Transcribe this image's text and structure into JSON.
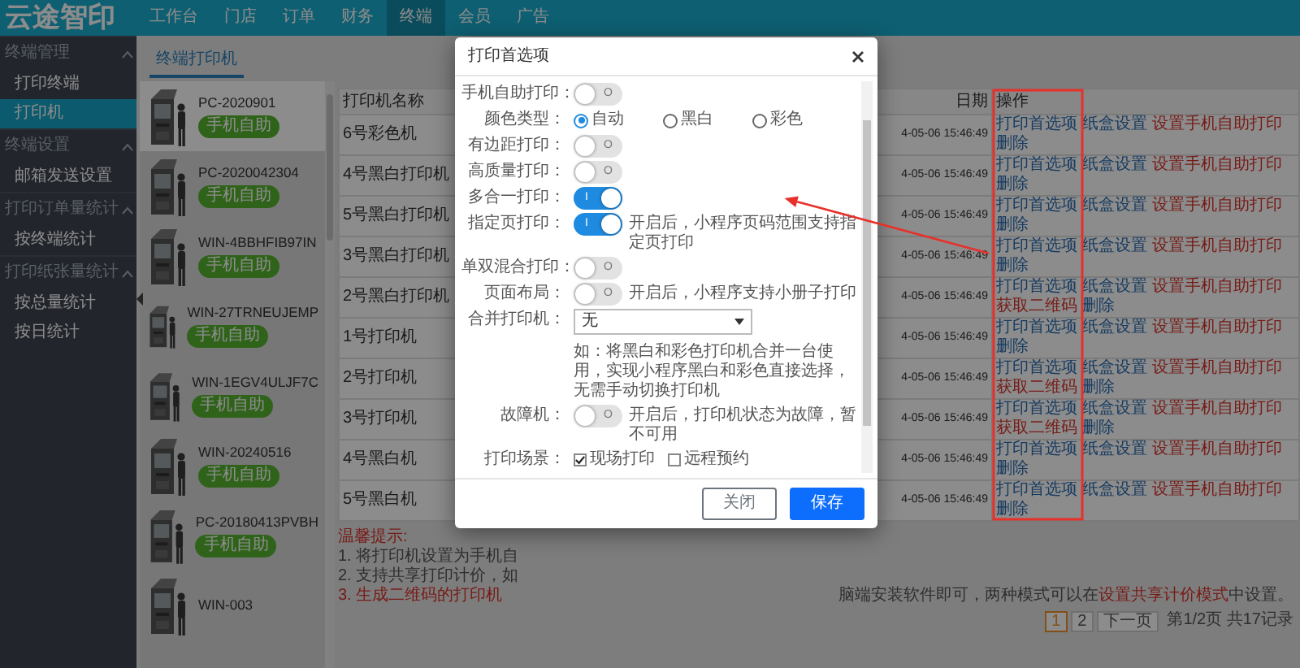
{
  "topbar": {
    "logo": "云途智印",
    "menu": [
      {
        "label": "工作台",
        "selected": false
      },
      {
        "label": "门店",
        "selected": false
      },
      {
        "label": "订单",
        "selected": false
      },
      {
        "label": "财务",
        "selected": false
      },
      {
        "label": "终端",
        "selected": true
      },
      {
        "label": "会员",
        "selected": false
      },
      {
        "label": "广告",
        "selected": false
      }
    ]
  },
  "sidebar": {
    "groups": [
      {
        "title": "终端管理",
        "expanded": true,
        "items": [
          {
            "label": "打印终端",
            "selected": false
          },
          {
            "label": "打印机",
            "selected": true
          }
        ]
      },
      {
        "title": "终端设置",
        "expanded": true,
        "items": [
          {
            "label": "邮箱发送设置",
            "selected": false
          }
        ]
      },
      {
        "title": "打印订单量统计",
        "expanded": true,
        "items": [
          {
            "label": "按终端统计",
            "selected": false
          }
        ]
      },
      {
        "title": "打印纸张量统计",
        "expanded": true,
        "items": [
          {
            "label": "按总量统计",
            "selected": false
          },
          {
            "label": "按日统计",
            "selected": false
          }
        ]
      }
    ]
  },
  "tabs": [
    {
      "label": "终端打印机",
      "selected": true
    }
  ],
  "devices": [
    {
      "name": "PC-2020901",
      "badge": "手机自助",
      "selected": true
    },
    {
      "name": "PC-2020042304",
      "badge": "手机自助",
      "selected": false
    },
    {
      "name": "WIN-4BBHFIB97IN",
      "badge": "手机自助",
      "selected": false
    },
    {
      "name": "WIN-27TRNEUJEMP",
      "badge": "手机自助",
      "selected": false
    },
    {
      "name": "WIN-1EGV4ULJF7C",
      "badge": "手机自助",
      "selected": false
    },
    {
      "name": "WIN-20240516",
      "badge": "手机自助",
      "selected": false
    },
    {
      "name": "PC-20180413PVBH",
      "badge": "手机自助",
      "selected": false
    },
    {
      "name": "WIN-003",
      "selected": false
    }
  ],
  "printer_table": {
    "columns": [
      "打印机名称",
      "日期",
      "操作"
    ],
    "rows": [
      {
        "name": "6号彩色机",
        "date": "4-05-06 15:46:49",
        "actions": [
          {
            "label": "打印首选项",
            "kind": "link"
          },
          {
            "label": "纸盒设置",
            "kind": "link"
          },
          {
            "label": "设置手机自助打印",
            "kind": "danger"
          },
          {
            "label": "删除",
            "kind": "link"
          }
        ]
      },
      {
        "name": "4号黑白打印机",
        "date": "4-05-06 15:46:49",
        "actions": [
          {
            "label": "打印首选项",
            "kind": "link"
          },
          {
            "label": "纸盒设置",
            "kind": "link"
          },
          {
            "label": "设置手机自助打印",
            "kind": "danger"
          },
          {
            "label": "删除",
            "kind": "link"
          }
        ]
      },
      {
        "name": "5号黑白打印机",
        "date": "4-05-06 15:46:49",
        "actions": [
          {
            "label": "打印首选项",
            "kind": "link"
          },
          {
            "label": "纸盒设置",
            "kind": "link"
          },
          {
            "label": "设置手机自助打印",
            "kind": "danger"
          },
          {
            "label": "删除",
            "kind": "link"
          }
        ]
      },
      {
        "name": "3号黑白打印机",
        "date": "4-05-06 15:46:49",
        "actions": [
          {
            "label": "打印首选项",
            "kind": "link"
          },
          {
            "label": "纸盒设置",
            "kind": "link"
          },
          {
            "label": "设置手机自助打印",
            "kind": "danger"
          },
          {
            "label": "删除",
            "kind": "link"
          }
        ]
      },
      {
        "name": "2号黑白打印机",
        "date": "4-05-06 15:46:49",
        "actions": [
          {
            "label": "打印首选项",
            "kind": "link"
          },
          {
            "label": "纸盒设置",
            "kind": "link"
          },
          {
            "label": "设置手机自助打印",
            "kind": "danger"
          },
          {
            "label": "获取二维码",
            "kind": "danger"
          },
          {
            "label": "删除",
            "kind": "link"
          }
        ]
      },
      {
        "name": "1号打印机",
        "date": "4-05-06 15:46:49",
        "actions": [
          {
            "label": "打印首选项",
            "kind": "link"
          },
          {
            "label": "纸盒设置",
            "kind": "link"
          },
          {
            "label": "设置手机自助打印",
            "kind": "danger"
          },
          {
            "label": "删除",
            "kind": "link"
          }
        ]
      },
      {
        "name": "2号打印机",
        "date": "4-05-06 15:46:49",
        "actions": [
          {
            "label": "打印首选项",
            "kind": "link"
          },
          {
            "label": "纸盒设置",
            "kind": "link"
          },
          {
            "label": "设置手机自助打印",
            "kind": "danger"
          },
          {
            "label": "获取二维码",
            "kind": "danger"
          },
          {
            "label": "删除",
            "kind": "link"
          }
        ]
      },
      {
        "name": "3号打印机",
        "date": "4-05-06 15:46:49",
        "actions": [
          {
            "label": "打印首选项",
            "kind": "link"
          },
          {
            "label": "纸盒设置",
            "kind": "link"
          },
          {
            "label": "设置手机自助打印",
            "kind": "danger"
          },
          {
            "label": "获取二维码",
            "kind": "danger"
          },
          {
            "label": "删除",
            "kind": "link"
          }
        ]
      },
      {
        "name": "4号黑白机",
        "date": "4-05-06 15:46:49",
        "actions": [
          {
            "label": "打印首选项",
            "kind": "link"
          },
          {
            "label": "纸盒设置",
            "kind": "link"
          },
          {
            "label": "设置手机自助打印",
            "kind": "danger"
          },
          {
            "label": "删除",
            "kind": "link"
          }
        ]
      },
      {
        "name": "5号黑白机",
        "date": "4-05-06 15:46:49",
        "actions": [
          {
            "label": "打印首选项",
            "kind": "link"
          },
          {
            "label": "纸盒设置",
            "kind": "link"
          },
          {
            "label": "设置手机自助打印",
            "kind": "danger"
          },
          {
            "label": "删除",
            "kind": "link"
          }
        ]
      }
    ]
  },
  "tips": {
    "title": "温馨提示:",
    "lines": [
      {
        "number": "1.",
        "text": "将打印机设置为手机自",
        "kind": "normal"
      },
      {
        "number": "2.",
        "text": "支持共享打印计价，如",
        "kind": "normal"
      },
      {
        "number": "3.",
        "text": "生成二维码的打印机",
        "kind": "warning",
        "tail": [
          {
            "text": "脑端安装软件即可，两种模式可以在",
            "kind": "normal"
          },
          {
            "text": "设置共享计价模式",
            "kind": "warning"
          },
          {
            "text": "中设置。",
            "kind": "normal"
          }
        ]
      }
    ]
  },
  "pagination": {
    "pages": [
      {
        "label": "1",
        "selected": true
      },
      {
        "label": "2",
        "selected": false
      }
    ],
    "next": "下一页",
    "summary": "第1/2页 共17记录"
  },
  "modal": {
    "title": "打印首选项",
    "fields": [
      {
        "label": "手机自助打印：",
        "kind": "toggle",
        "on": false,
        "symbol": "O"
      },
      {
        "label": "颜色类型：",
        "kind": "radio",
        "options": [
          {
            "label": "自动",
            "selected": true
          },
          {
            "label": "黑白",
            "selected": false
          },
          {
            "label": "彩色",
            "selected": false
          }
        ]
      },
      {
        "label": "有边距打印：",
        "kind": "toggle",
        "on": false,
        "symbol": "O"
      },
      {
        "label": "高质量打印：",
        "kind": "toggle",
        "on": false,
        "symbol": "O"
      },
      {
        "label": "多合一打印：",
        "kind": "toggle",
        "on": true,
        "symbol": "I"
      },
      {
        "label": "指定页打印：",
        "kind": "toggle",
        "on": true,
        "symbol": "I",
        "hint": "开启后，小程序页码范围支持指定页打印"
      },
      {
        "label": "单双混合打印：",
        "kind": "toggle",
        "on": false,
        "symbol": "O"
      },
      {
        "label": "页面布局：",
        "kind": "toggle",
        "on": false,
        "symbol": "O",
        "hint": "开启后，小程序支持小册子打印"
      },
      {
        "label": "合并打印机：",
        "kind": "select",
        "value": "无",
        "hint": "如：将黑白和彩色打印机合并一台使用，实现小程序黑白和彩色直接选择，无需手动切换打印机"
      },
      {
        "label": "故障机：",
        "kind": "toggle",
        "on": false,
        "symbol": "O",
        "hint": "开启后，打印机状态为故障，暂不可用"
      },
      {
        "label": "打印场景：",
        "kind": "checks",
        "options": [
          {
            "label": "现场打印",
            "checked": true
          },
          {
            "label": "远程预约",
            "checked": false
          }
        ]
      }
    ],
    "buttons": [
      {
        "label": "关闭",
        "kind": "secondary"
      },
      {
        "label": "保存",
        "kind": "primary"
      }
    ]
  }
}
